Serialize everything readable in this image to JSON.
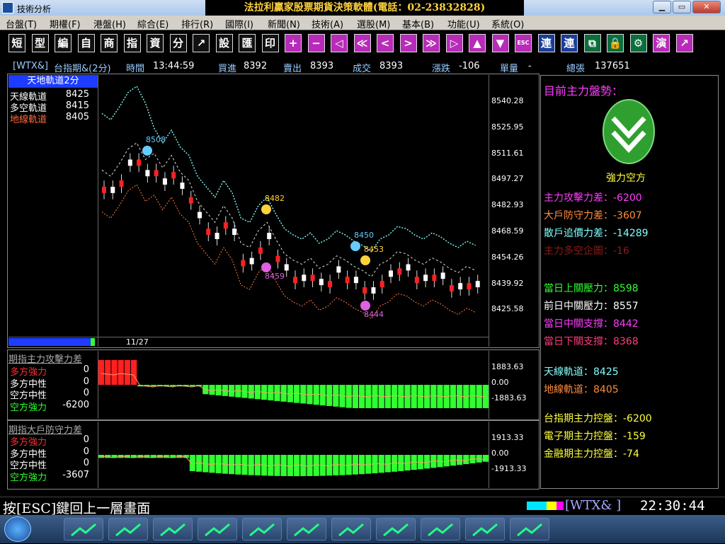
{
  "window": {
    "app_title": "技術分析",
    "center_title": "法拉利贏家股票期貨決策軟體(電話：02-23832828)",
    "btn_min": "▭",
    "btn_max": "▭",
    "btn_close": "✕"
  },
  "menu": [
    "台盤(T)",
    "期權(F)",
    "港盤(H)",
    "綜合(E)",
    "排行(R)",
    "國際(I)",
    "新聞(N)",
    "技術(A)",
    "選股(M)",
    "基本(B)",
    "功能(U)",
    "系統(O)"
  ],
  "toolbar": [
    "短",
    "型",
    "編",
    "自",
    "商",
    "指",
    "資",
    "分",
    "↗",
    "設",
    "匯",
    "印",
    "+",
    "−",
    "◁",
    "≪",
    "<",
    ">",
    "≫",
    "▷",
    "▲",
    "▼",
    "ESC",
    "連",
    "連",
    "⧉",
    "🔒",
    "⚙",
    "演",
    "↗"
  ],
  "info": {
    "symbol": "[WTX&]",
    "name": "台指期&(2分)",
    "time_label": "時間",
    "time": "13:44:59",
    "buy_label": "買進",
    "buy": "8392",
    "sell_label": "賣出",
    "sell": "8393",
    "deal_label": "成交",
    "deal": "8393",
    "change_label": "漲跌",
    "change": "-106",
    "vol_label": "單量",
    "vol": "-",
    "total_label": "總張",
    "total": "137651"
  },
  "legend_main": {
    "title": "天地軌道2分",
    "items": [
      {
        "label": "天線軌道",
        "value": "8425",
        "color": "#ffffff"
      },
      {
        "label": "多空軌道",
        "value": "8415",
        "color": "#ffffff"
      },
      {
        "label": "地線軌道",
        "value": "8405",
        "color": "#ff6a3c"
      }
    ]
  },
  "yaxis_main": [
    "8540.28",
    "8525.95",
    "8511.61",
    "8497.27",
    "8482.93",
    "8468.59",
    "8454.26",
    "8439.92",
    "8425.58"
  ],
  "date_label": "11/27",
  "markers": [
    {
      "label": "8508",
      "color": "#6cf"
    },
    {
      "label": "8482",
      "color": "#ffd23c"
    },
    {
      "label": "8459",
      "color": "#e060e0"
    },
    {
      "label": "8450",
      "color": "#6cf"
    },
    {
      "label": "8453",
      "color": "#ffd23c"
    },
    {
      "label": "8444",
      "color": "#e060e0"
    }
  ],
  "sub1": {
    "title": "期指主力攻擊力差",
    "rows": [
      {
        "label": "多方強力",
        "value": "0",
        "color": "#ff3030"
      },
      {
        "label": "多方中性",
        "value": "0",
        "color": "#ffffff"
      },
      {
        "label": "空方中性",
        "value": "0",
        "color": "#ffffff"
      },
      {
        "label": "空方強力",
        "value": "-6200",
        "color": "#30ff30"
      }
    ],
    "yaxis": [
      "1883.63",
      "0.00",
      "-1883.63"
    ]
  },
  "sub2": {
    "title": "期指大戶防守力差",
    "rows": [
      {
        "label": "多方強力",
        "value": "0",
        "color": "#ff3030"
      },
      {
        "label": "多方中性",
        "value": "0",
        "color": "#ffffff"
      },
      {
        "label": "空方中性",
        "value": "0",
        "color": "#ffffff"
      },
      {
        "label": "空方強力",
        "value": "-3607",
        "color": "#30ff30"
      }
    ],
    "yaxis": [
      "1913.33",
      "0.00",
      "-1913.33"
    ]
  },
  "right": {
    "heading": "目前主力盤勢：",
    "trend": "強力空方",
    "lines1": [
      {
        "text": "主力攻擊力差：-6200",
        "color": "#ff3cff"
      },
      {
        "text": "大戶防守力差：-3607",
        "color": "#ff8c3c"
      },
      {
        "text": "散戶追價力差：-14289",
        "color": "#7fffff"
      },
      {
        "text": "主力多空企圖：-16",
        "color": "#8a1c1c"
      }
    ],
    "lines2": [
      {
        "text": "當日上關壓力：8598",
        "color": "#30ff30"
      },
      {
        "text": "前日中關壓力：8557",
        "color": "#ffffff"
      },
      {
        "text": "當日中關支撐：8442",
        "color": "#ff3cff"
      },
      {
        "text": "當日下關支撐：8368",
        "color": "#ff3c7a"
      }
    ],
    "lines3": [
      {
        "text": "天線軌道：8425",
        "color": "#7fffff"
      },
      {
        "text": "地線軌道：8405",
        "color": "#ff8c3c"
      }
    ],
    "lines4": [
      {
        "text": "台指期主力控盤：-6200",
        "color": "#ffff3c"
      },
      {
        "text": "電子期主力控盤：-159",
        "color": "#ffff3c"
      },
      {
        "text": "金融期主力控盤：-74",
        "color": "#ffff3c"
      }
    ]
  },
  "status": {
    "hint": "按[ESC]鍵回上一層畫面",
    "symbol": "[WTX&   ]",
    "clock": "22:30:44"
  }
}
